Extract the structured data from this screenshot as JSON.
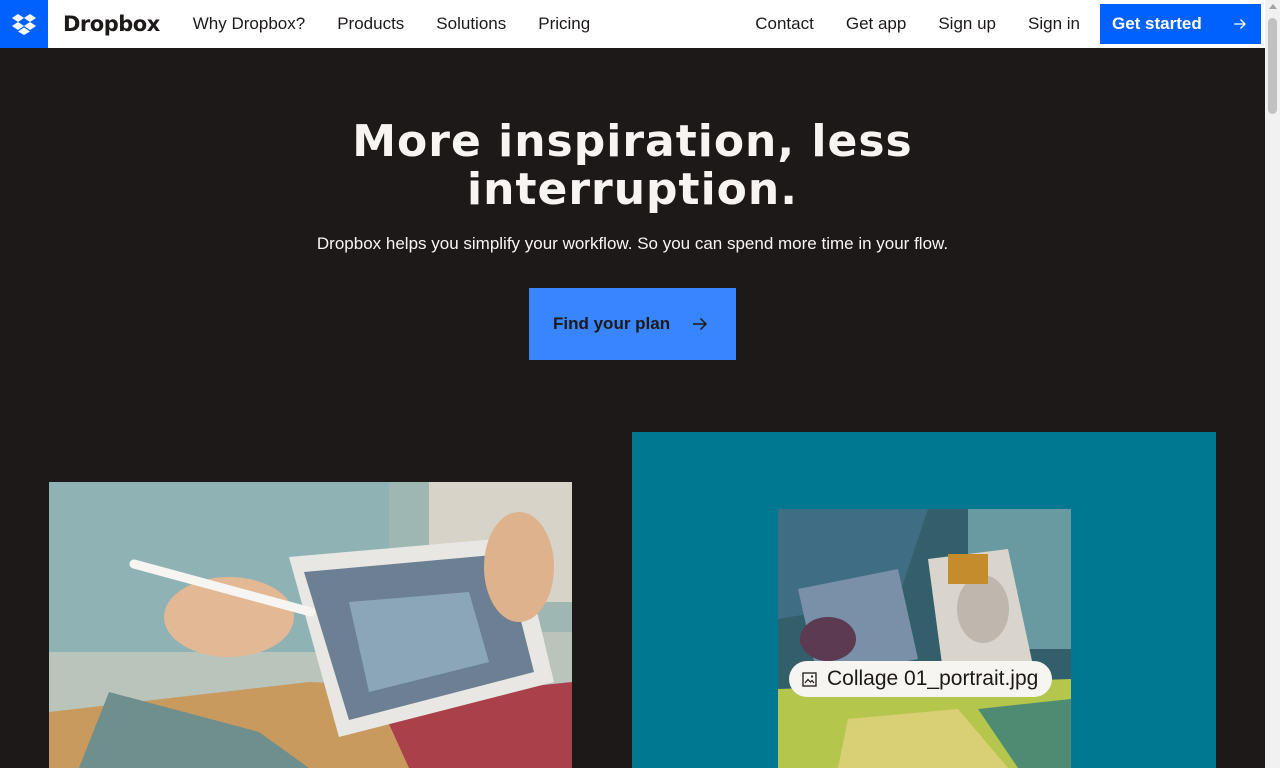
{
  "header": {
    "brand": "Dropbox",
    "nav_left": [
      "Why Dropbox?",
      "Products",
      "Solutions",
      "Pricing"
    ],
    "nav_right": [
      "Contact",
      "Get app",
      "Sign up",
      "Sign in"
    ],
    "cta_label": "Get started"
  },
  "hero": {
    "title_line1": "More inspiration,  less",
    "title_line2": "interruption.",
    "subtitle": "Dropbox helps you simplify your workflow.  So you can spend more time in your flow.",
    "button_label": "Find your plan"
  },
  "showcase": {
    "file_name": "Collage 01_portrait.jpg"
  },
  "colors": {
    "brand_blue": "#0061fe",
    "button_blue": "#3984ff",
    "background": "#1e1919",
    "teal": "#007891"
  },
  "icons": {
    "logo": "dropbox-logo-icon",
    "arrow": "arrow-right-icon",
    "file": "image-file-icon"
  }
}
